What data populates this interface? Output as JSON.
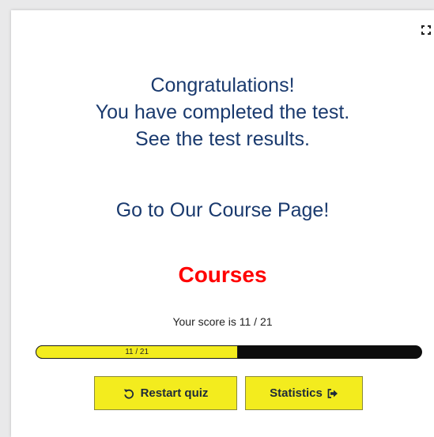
{
  "message": {
    "line1": "Congratulations!",
    "line2": "You have completed the test.",
    "line3": "See the test results."
  },
  "course_link": "Go to Our Course Page!",
  "courses_heading": "Courses",
  "score_text": "Your score is 11 / 21",
  "progress": {
    "label": "11 / 21",
    "fraction": 0.524
  },
  "buttons": {
    "restart": "Restart quiz",
    "statistics": "Statistics"
  },
  "icons": {
    "fullscreen": "fullscreen-icon",
    "restart": "restart-icon",
    "statistics": "sign-out-icon"
  },
  "colors": {
    "accent_yellow": "#f3ec1e",
    "heading_red": "#ff0000",
    "text_blue": "#1a3a6e",
    "bar_track": "#0d0d0d"
  }
}
